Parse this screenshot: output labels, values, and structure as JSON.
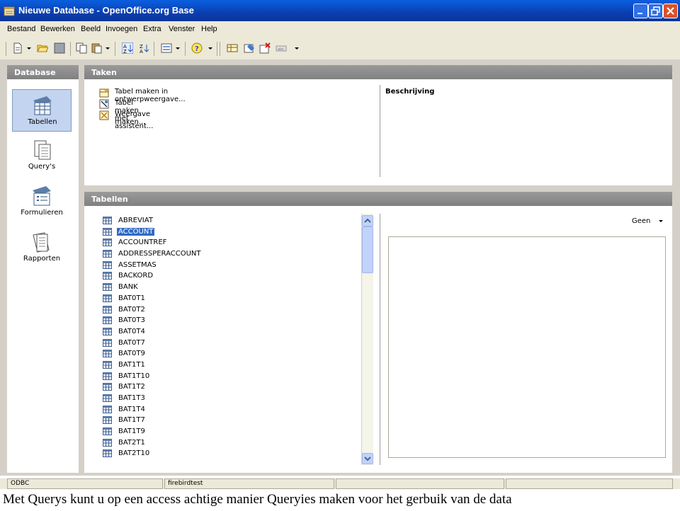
{
  "window": {
    "title": "Nieuwe Database - OpenOffice.org Base",
    "title_icon": "base-app-icon",
    "controls": [
      "minimize-icon",
      "maximize-icon",
      "close-icon"
    ]
  },
  "menubar": {
    "items": [
      "Bestand",
      "Bewerken",
      "Beeld",
      "Invoegen",
      "Extra",
      "Venster",
      "Help"
    ]
  },
  "toolbar": {
    "icons": [
      "new-document-icon",
      "open-folder-icon",
      "save-icon",
      "copy-icon",
      "paste-icon",
      "sort-ascending-icon",
      "sort-descending-icon",
      "form-icon",
      "help-icon",
      "table-icon",
      "query-icon",
      "delete-icon",
      "rename-icon"
    ]
  },
  "database_panel": {
    "title": "Database",
    "items": [
      {
        "label": "Tabellen",
        "icon": "tables-icon",
        "selected": true
      },
      {
        "label": "Query's",
        "icon": "queries-icon",
        "selected": false
      },
      {
        "label": "Formulieren",
        "icon": "forms-icon",
        "selected": false
      },
      {
        "label": "Rapporten",
        "icon": "reports-icon",
        "selected": false
      }
    ]
  },
  "tasks_panel": {
    "title": "Taken",
    "tasks": [
      {
        "label": "Tabel maken in ontwerpweergave...",
        "icon": "design-view-icon"
      },
      {
        "label": "Tabel maken met assistent...",
        "icon": "wizard-icon"
      },
      {
        "label": "Weergave maken...",
        "icon": "view-icon"
      }
    ],
    "description_label": "Beschrijving"
  },
  "tables_panel": {
    "title": "Tabellen",
    "tables": [
      "ABREVIAT",
      "ACCOUNT",
      "ACCOUNTREF",
      "ADDRESSPERACCOUNT",
      "ASSETMAS",
      "BACKORD",
      "BANK",
      "BAT0T1",
      "BAT0T2",
      "BAT0T3",
      "BAT0T4",
      "BAT0T7",
      "BAT0T9",
      "BAT1T1",
      "BAT1T10",
      "BAT1T2",
      "BAT1T3",
      "BAT1T4",
      "BAT1T7",
      "BAT1T9",
      "BAT2T1",
      "BAT2T10"
    ],
    "selected_index": 1,
    "preview_option": "Geen"
  },
  "statusbar": {
    "connection_type": "ODBC",
    "database_name": "firebirdtest"
  },
  "caption": "Met Querys kunt u op een access achtige manier Queryies maken voor het gerbuik van de data",
  "colors": {
    "titlebar": "#0a3fb0",
    "panel_header": "#808080",
    "selection": "#316ac5",
    "chrome": "#ece9d8"
  }
}
